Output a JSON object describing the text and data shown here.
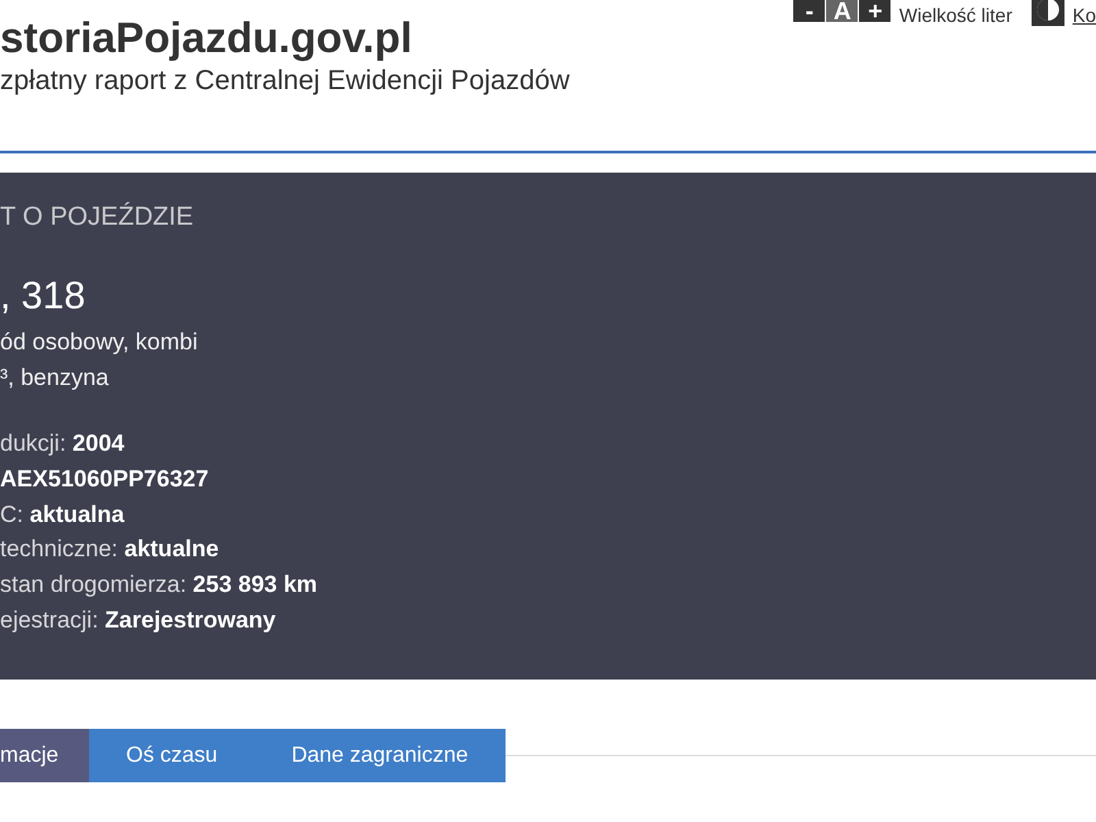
{
  "header": {
    "title": "storiaPojazdu.gov.pl",
    "subtitle": "zpłatny raport z Centralnej Ewidencji Pojazdów"
  },
  "font_controls": {
    "buttons": [
      "-",
      "A",
      "+"
    ],
    "label": "Wielkość liter"
  },
  "contrast_link": "Ko",
  "vehicle_panel": {
    "heading": "T O POJEŹDZIE",
    "model": ", 318",
    "description": [
      "ód osobowy, kombi",
      "³, benzyna"
    ],
    "details": [
      "dukcji: **2004**",
      "**AEX51060PP76327**",
      "C: **aktualna**",
      " techniczne: **aktualne**",
      "stan drogomierza: **253 893 km**",
      "ejestracji: **Zarejestrowany**"
    ]
  },
  "tabs": [
    {
      "label": "macje",
      "selected": true
    },
    {
      "label": "Oś czasu",
      "selected": false
    },
    {
      "label": "Dane zagraniczne",
      "selected": false
    }
  ]
}
